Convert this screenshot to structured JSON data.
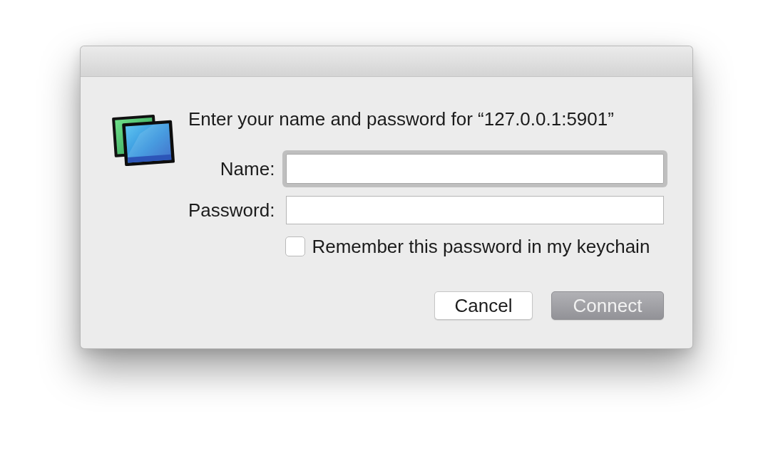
{
  "dialog": {
    "message": "Enter your name and password for “127.0.0.1:5901”"
  },
  "fields": [
    {
      "label": "Name:",
      "focused": true
    },
    {
      "label": "Password:",
      "focused": false
    }
  ],
  "remember": {
    "label": "Remember this password in my keychain",
    "checked": false
  },
  "buttons": [
    {
      "label": "Cancel",
      "disabled": false
    },
    {
      "label": "Connect",
      "disabled": true
    }
  ]
}
